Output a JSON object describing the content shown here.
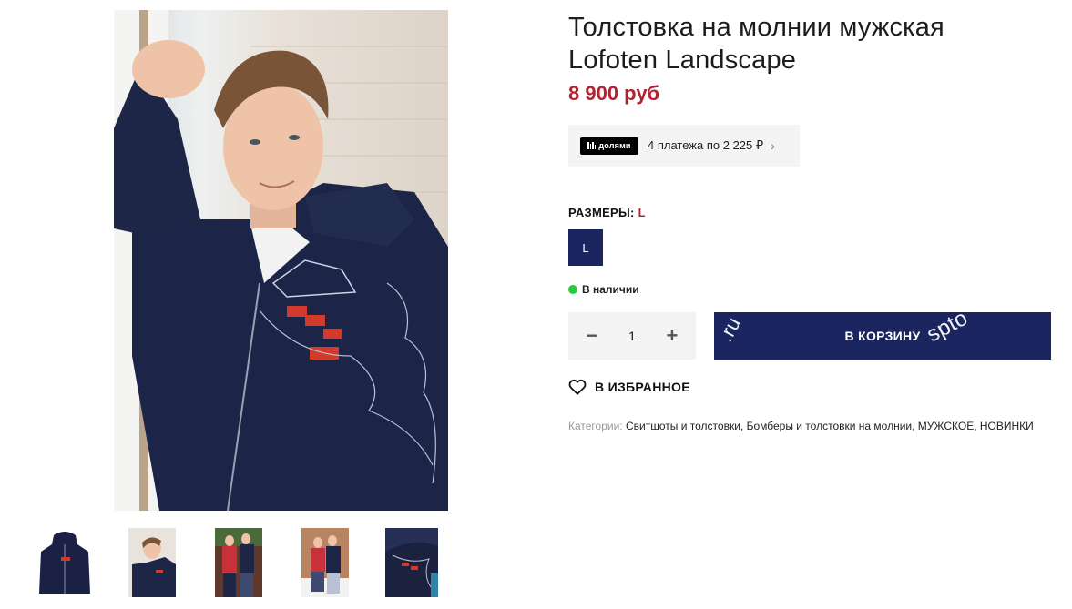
{
  "product": {
    "title_line1": "Толстовка на молнии мужская",
    "title_line2": "Lofoten Landscape",
    "price": "8 900 руб"
  },
  "installments": {
    "logo_text": "долями",
    "text": "4 платежа по 2 225 ₽",
    "chevron_icon": "chevron-right-icon"
  },
  "sizes": {
    "label": "РАЗМЕРЫ:",
    "selected": "L",
    "options": [
      "L"
    ]
  },
  "stock": {
    "text": "В наличии",
    "color": "#2bc83a"
  },
  "quantity": {
    "minus": "−",
    "value": "1",
    "plus": "+"
  },
  "cart": {
    "label": "В КОРЗИНУ",
    "watermark_1": ".ru",
    "watermark_2": "spto"
  },
  "favorite": {
    "label": "В ИЗБРАННОЕ",
    "icon": "heart-icon"
  },
  "categories": {
    "label": "Категории:",
    "items": [
      "Свитшоты и толстовки",
      "Бомберы и толстовки на молнии",
      "МУЖСКОЕ",
      "НОВИНКИ"
    ]
  },
  "colors": {
    "accent_navy": "#1b2560",
    "price_red": "#b3222f"
  }
}
